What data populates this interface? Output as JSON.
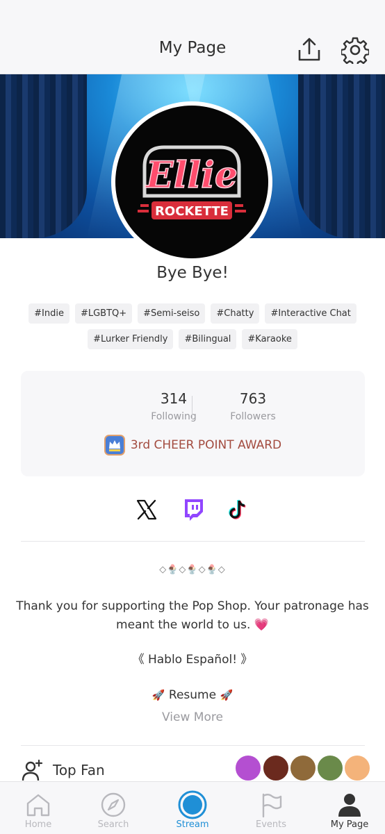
{
  "header": {
    "title": "My Page",
    "share_icon": "share-upload-icon",
    "settings_icon": "gear-icon"
  },
  "profile": {
    "logo_text_top": "Ellie",
    "logo_text_bottom": "ROCKETTE",
    "status": "Bye Bye!"
  },
  "tags": {
    "row1": [
      "#Indie",
      "#LGBTQ+",
      "#Semi-seiso",
      "#Chatty",
      "#Interactive Chat"
    ],
    "row2": [
      "#Lurker Friendly",
      "#Bilingual",
      "#Karaoke"
    ]
  },
  "stats": {
    "following_count": "314",
    "following_label": "Following",
    "followers_count": "763",
    "followers_label": "Followers",
    "award_text": "3rd CHEER POINT AWARD"
  },
  "social": [
    "x-icon",
    "twitch-icon",
    "tiktok-icon"
  ],
  "bio": {
    "decoration": "◇🍨◇🍨◇🍨◇",
    "line1": "Thank you for supporting the Pop Shop. Your patronage has meant the world to us.",
    "heart": "💗",
    "line2": "《 Hablo Español! 》",
    "resume_prefix": "🚀",
    "resume": " Resume ",
    "resume_suffix": "🚀",
    "view_more": "View More"
  },
  "top_fan": {
    "label": "Top Fan",
    "fan_colors": [
      "#b44fd1",
      "#6b2a1e",
      "#8f6a3a",
      "#6a8a4a",
      "#f4b37a"
    ]
  },
  "tabs": [
    {
      "label": "Home"
    },
    {
      "label": "Search"
    },
    {
      "label": "Stream"
    },
    {
      "label": "Events"
    },
    {
      "label": "My Page"
    }
  ],
  "colors": {
    "accent": "#1f8fd6",
    "award": "#a34b3f"
  }
}
